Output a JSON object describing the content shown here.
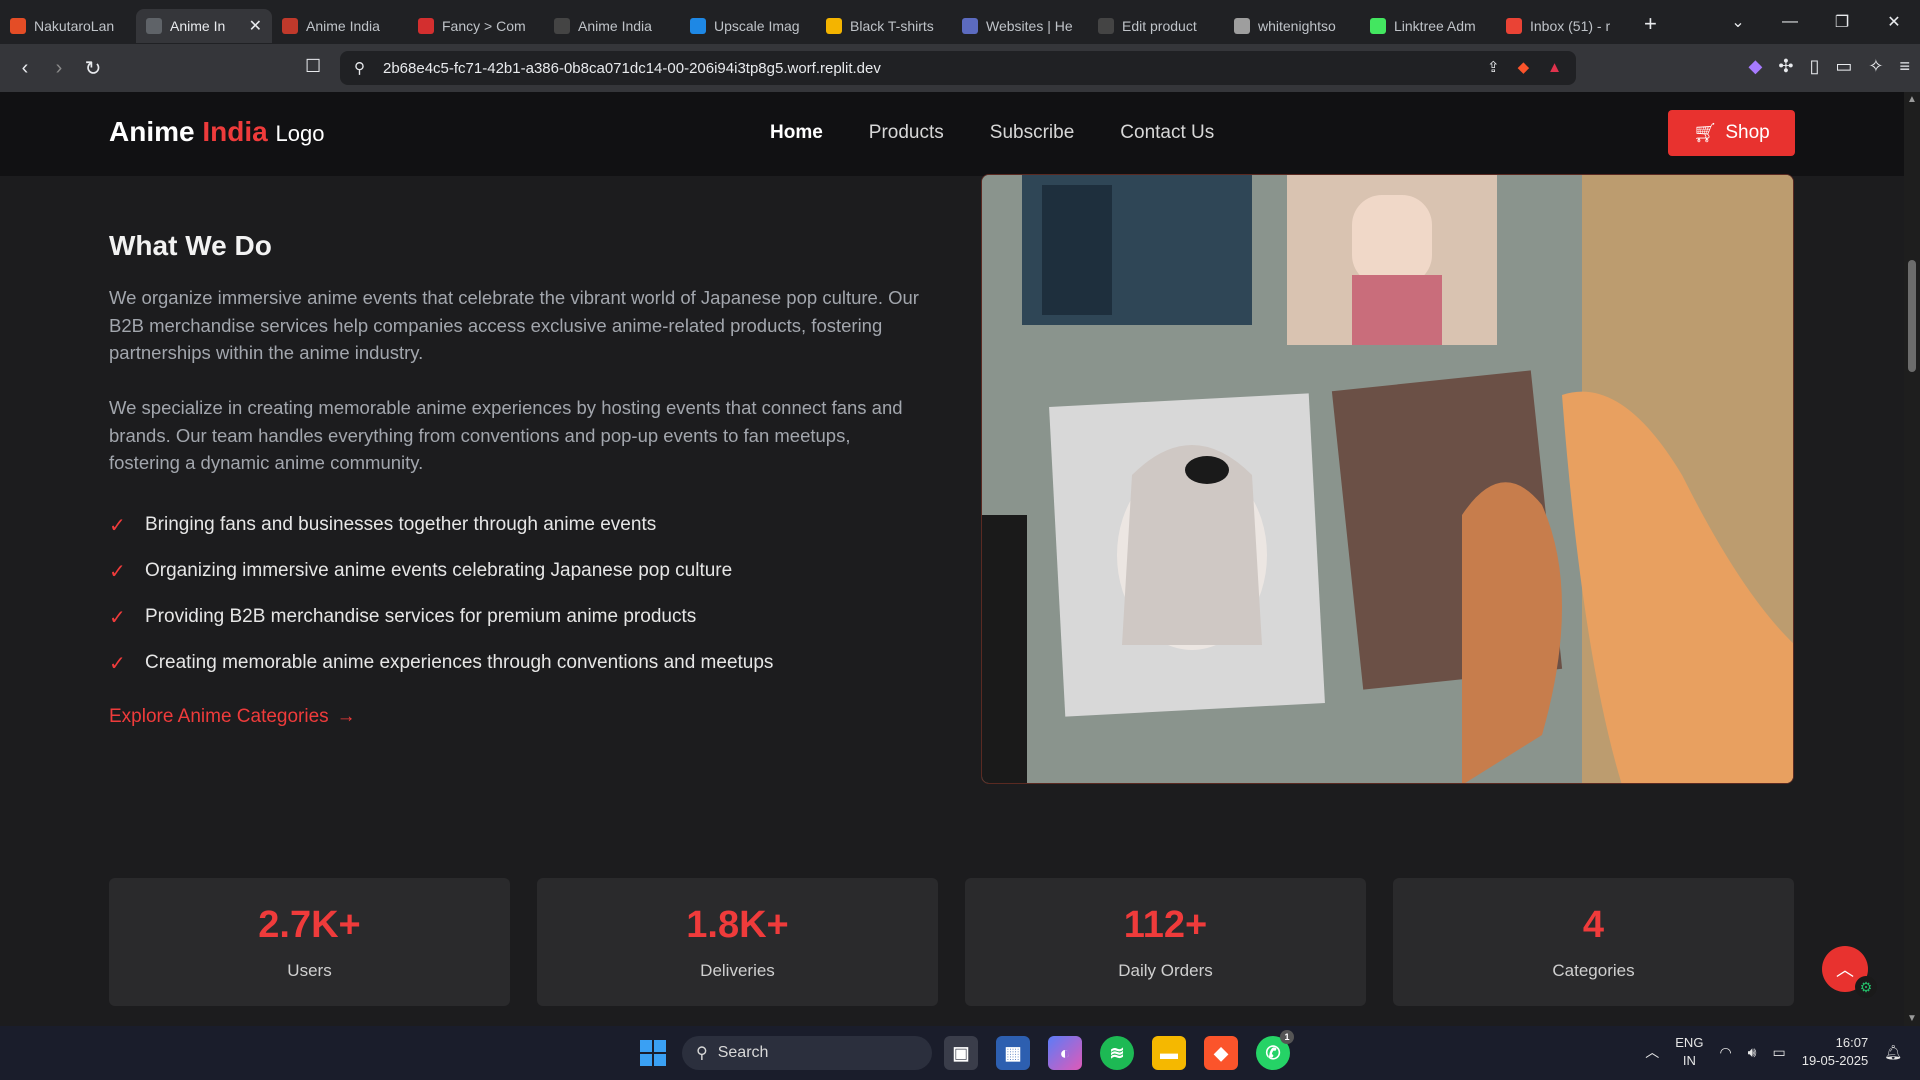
{
  "browser": {
    "tabs": [
      {
        "title": "NakutaroLan",
        "active": false,
        "icon": "app-icon",
        "color": "#e44d26"
      },
      {
        "title": "Anime In",
        "active": true,
        "icon": "globe-icon",
        "color": "#5f6368"
      },
      {
        "title": "Anime India",
        "active": false,
        "icon": "anime-icon",
        "color": "#c0392b"
      },
      {
        "title": "Fancy > Com",
        "active": false,
        "icon": "fancy-icon",
        "color": "#d32f2f"
      },
      {
        "title": "Anime India",
        "active": false,
        "icon": "anime-icon",
        "color": "#444"
      },
      {
        "title": "Upscale Imag",
        "active": false,
        "icon": "upscale-icon",
        "color": "#1e88e5"
      },
      {
        "title": "Black T-shirts",
        "active": false,
        "icon": "drive-icon",
        "color": "#f4b400"
      },
      {
        "title": "Websites | He",
        "active": false,
        "icon": "websites-icon",
        "color": "#5c6bc0"
      },
      {
        "title": "Edit product",
        "active": false,
        "icon": "anime-icon",
        "color": "#444"
      },
      {
        "title": "whitenightso",
        "active": false,
        "icon": "bank-icon",
        "color": "#9e9e9e"
      },
      {
        "title": "Linktree Adm",
        "active": false,
        "icon": "linktree-icon",
        "color": "#43e660"
      },
      {
        "title": "Inbox (51) - r",
        "active": false,
        "icon": "gmail-icon",
        "color": "#ea4335"
      }
    ],
    "new_tab": "+",
    "url": "2b68e4c5-fc71-42b1-a386-0b8ca071dc14-00-206i94i3tp8g5.worf.replit.dev"
  },
  "site": {
    "logo": {
      "part1": "Anime",
      "part2": "India",
      "part3": "Logo"
    },
    "nav": [
      {
        "label": "Home",
        "active": true
      },
      {
        "label": "Products",
        "active": false
      },
      {
        "label": "Subscribe",
        "active": false
      },
      {
        "label": "Contact Us",
        "active": false
      }
    ],
    "shop_label": "Shop",
    "about": {
      "title": "What We Do",
      "p1": "We organize immersive anime events that celebrate the vibrant world of Japanese pop culture. Our B2B merchandise services help companies access exclusive anime-related products, fostering partnerships within the anime industry.",
      "p2": "We specialize in creating memorable anime experiences by hosting events that connect fans and brands. Our team handles everything from conventions and pop-up events to fan meetups, fostering a dynamic anime community.",
      "features": [
        "Bringing fans and businesses together through anime events",
        "Organizing immersive anime events celebrating Japanese pop culture",
        "Providing B2B merchandise services for premium anime products",
        "Creating memorable anime experiences through conventions and meetups"
      ],
      "explore_label": "Explore Anime Categories"
    },
    "stats": [
      {
        "value": "2.7K+",
        "label": "Users"
      },
      {
        "value": "1.8K+",
        "label": "Deliveries"
      },
      {
        "value": "112+",
        "label": "Daily Orders"
      },
      {
        "value": "4",
        "label": "Categories"
      }
    ],
    "accent_color": "#ef3b3b"
  },
  "taskbar": {
    "search_label": "Search",
    "lang_line1": "ENG",
    "lang_line2": "IN",
    "time": "16:07",
    "date": "19-05-2025",
    "whatsapp_badge": "1"
  }
}
